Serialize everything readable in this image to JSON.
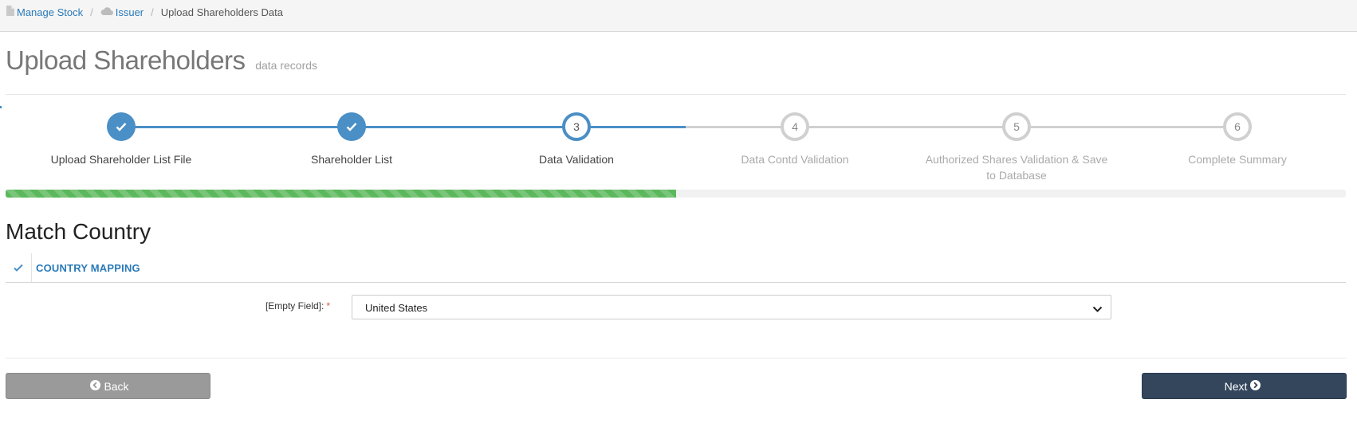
{
  "breadcrumb": {
    "item1": "Manage Stock",
    "item2": "Issuer",
    "current": "Upload Shareholders Data",
    "separator": "/"
  },
  "page": {
    "title": "Upload Shareholders",
    "subtitle": "data records"
  },
  "steps": [
    {
      "number": "1",
      "label": "Upload Shareholder List File",
      "state": "done"
    },
    {
      "number": "2",
      "label": "Shareholder List",
      "state": "done"
    },
    {
      "number": "3",
      "label": "Data Validation",
      "state": "active"
    },
    {
      "number": "4",
      "label": "Data Contd Validation",
      "state": "todo"
    },
    {
      "number": "5",
      "label": "Authorized Shares Validation & Save to Database",
      "state": "todo"
    },
    {
      "number": "6",
      "label": "Complete Summary",
      "state": "todo"
    }
  ],
  "progress": {
    "percent": 50
  },
  "section": {
    "title": "Match Country",
    "tab_label": "COUNTRY MAPPING"
  },
  "field": {
    "label": "[Empty Field]:",
    "required_mark": "*",
    "selected_value": "United States"
  },
  "buttons": {
    "back": "Back",
    "next": "Next"
  },
  "colors": {
    "accent": "#4a8fc6",
    "progress": "#5cb85c",
    "next_button": "#33465c",
    "back_button": "#9a9a9a",
    "link": "#2a7ab8"
  }
}
